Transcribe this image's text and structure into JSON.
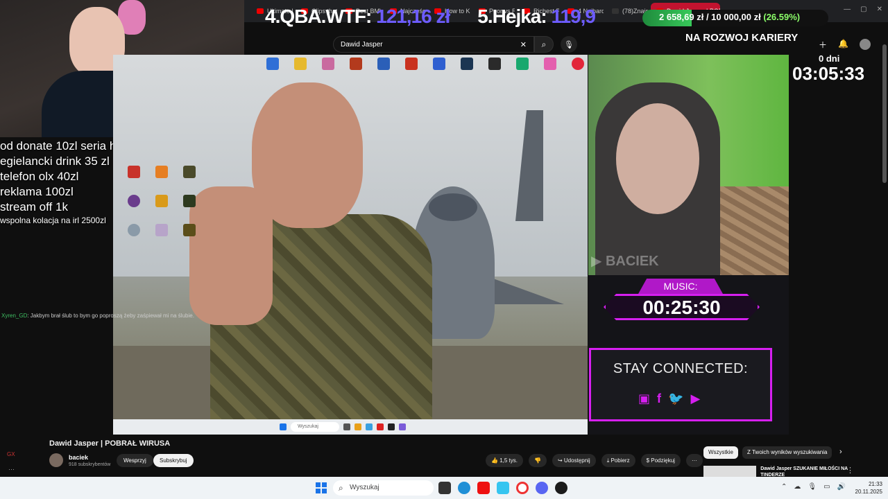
{
  "browser": {
    "tabs": [
      "Ultimate P...",
      "Clips that ...",
      "Best BMW I...",
      "Najczęściej...",
      "How to Kr...",
      "Poor vs Ric...",
      "Richest Pe...",
      "4 Najbardz...",
      "(78)Znajdź...",
      "Dawid Jasper | POBR..."
    ],
    "window_controls": [
      "—",
      "▢",
      "✕"
    ]
  },
  "overlay": {
    "rank4_label": "4.QBA.WTF:",
    "rank4_value": "121,16 zł",
    "rank5_label": "5.Hejka:",
    "rank5_value": "119,9",
    "goal_text": "2 658,69 zł / 10 000,00 zł",
    "goal_percent_text": "(26.59%)",
    "goal_fraction": 0.2659,
    "goal_title": "NA ROZWOJ KARIERY",
    "timer_days": "0 dni",
    "timer_clock": "03:05:33",
    "donations": [
      "od donate 10zl seria hantla 15 kg",
      "egielancki drink 35 zl",
      "telefon olx 40zl",
      "reklama 100zl",
      "stream off 1k"
    ],
    "donation_small": "wspolna kolacja na irl 2500zl",
    "chat_user": "Xyren_GD",
    "chat_text": ": Jakbym brał ślub to bym go poproszą żeby zaśpiewał mi na ślubie.",
    "music_label": "MUSIC:",
    "music_time": "00:25:30",
    "stay_connected": "STAY CONNECTED:",
    "cam_watermark": "▶ BACIEK"
  },
  "youtube": {
    "search_value": "Dawid Jasper",
    "video_title": "Dawid Jasper | POBRAŁ WIRUSA",
    "channel_name": "baciek",
    "channel_subs": "918 subskrybentów",
    "support_label": "Wesprzyj",
    "subscribe_label": "Subskrybuj",
    "likes": "1,5 tys.",
    "share_label": "Udostępnij",
    "download_label": "Pobierz",
    "thanks_label": "Podziękuj",
    "chip_all": "Wszystkie",
    "chip_results": "Z Twoich wyników wyszukiwania",
    "rec_title": "Dawid Jasper SZUKANIE MIŁOŚCI NA TINDERZE"
  },
  "video_desktop": {
    "search_text": "Wyszukaj"
  },
  "taskbar": {
    "search_placeholder": "Wyszukaj",
    "time": "21:33",
    "date": "20.11.2025"
  },
  "left_widgets": {
    "gx": "GX",
    "dots": "···"
  }
}
